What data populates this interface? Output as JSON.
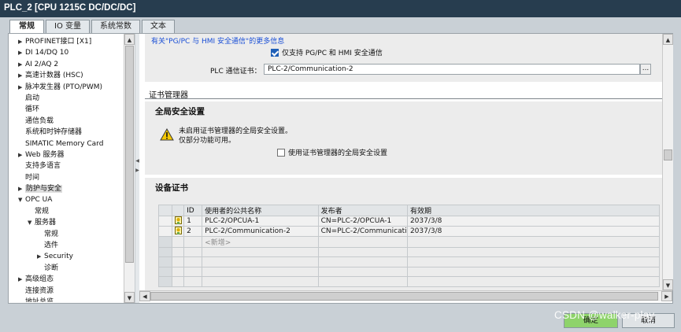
{
  "window": {
    "title": "PLC_2 [CPU 1215C DC/DC/DC]"
  },
  "tabs": [
    {
      "label": "常规",
      "active": true
    },
    {
      "label": "IO 变量",
      "active": false
    },
    {
      "label": "系统常数",
      "active": false
    },
    {
      "label": "文本",
      "active": false
    }
  ],
  "tree": {
    "items": [
      {
        "label": "PROFINET接口 [X1]",
        "arrow": "▶",
        "selected": false
      },
      {
        "label": "DI 14/DQ 10",
        "arrow": "▶",
        "selected": false
      },
      {
        "label": "AI 2/AQ 2",
        "arrow": "▶",
        "selected": false
      },
      {
        "label": "高速计数器 (HSC)",
        "arrow": "▶",
        "selected": false
      },
      {
        "label": "脉冲发生器 (PTO/PWM)",
        "arrow": "▶",
        "selected": false
      },
      {
        "label": "启动",
        "arrow": "",
        "selected": false
      },
      {
        "label": "循环",
        "arrow": "",
        "selected": false
      },
      {
        "label": "通信负载",
        "arrow": "",
        "selected": false
      },
      {
        "label": "系统和时钟存储器",
        "arrow": "",
        "selected": false
      },
      {
        "label": "SIMATIC Memory Card",
        "arrow": "",
        "selected": false
      },
      {
        "label": "Web 服务器",
        "arrow": "▶",
        "selected": false
      },
      {
        "label": "支持多语言",
        "arrow": "",
        "selected": false
      },
      {
        "label": "时间",
        "arrow": "",
        "selected": false
      },
      {
        "label": "防护与安全",
        "arrow": "▶",
        "selected": true
      },
      {
        "label": "OPC UA",
        "arrow": "▼",
        "selected": false
      },
      {
        "label": "常规",
        "arrow": "",
        "selected": false
      },
      {
        "label": "服务器",
        "arrow": "▼",
        "selected": false
      },
      {
        "label": "常规",
        "arrow": "",
        "selected": false
      },
      {
        "label": "选件",
        "arrow": "",
        "selected": false
      },
      {
        "label": "Security",
        "arrow": "▶",
        "selected": false
      },
      {
        "label": "诊断",
        "arrow": "",
        "selected": false
      },
      {
        "label": "高级组态",
        "arrow": "▶",
        "selected": false
      },
      {
        "label": "连接资源",
        "arrow": "",
        "selected": false
      },
      {
        "label": "地址总览",
        "arrow": "",
        "selected": false
      }
    ]
  },
  "comm": {
    "more_info_link": "有关\"PG/PC 与 HMI 安全通信\"的更多信息",
    "only_secure_label": "仅支持 PG/PC 和 HMI 安全通信",
    "only_secure_checked": true,
    "cert_label": "PLC 通信证书：",
    "cert_value": "PLC-2/Communication-2",
    "browse_label": "..."
  },
  "cert_manager": {
    "heading": "证书管理器",
    "global_heading": "全局安全设置",
    "warning_line1": "未启用证书管理器的全局安全设置。",
    "warning_line2": "仅部分功能可用。",
    "use_global_label": "使用证书管理器的全局安全设置",
    "use_global_checked": false
  },
  "device_certs": {
    "heading": "设备证书",
    "columns": [
      "ID",
      "使用者的公共名称",
      "发布者",
      "有效期"
    ],
    "rows": [
      {
        "id": "1",
        "subject": "PLC-2/OPCUA-1",
        "issuer": "CN=PLC-2/OPCUA-1",
        "valid": "2037/3/8"
      },
      {
        "id": "2",
        "subject": "PLC-2/Communication-2",
        "issuer": "CN=PLC-2/Communicati...",
        "valid": "2037/3/8"
      }
    ],
    "new_row_label": "<新增>"
  },
  "footer": {
    "ok_label": "确定",
    "cancel_label": "取消"
  },
  "watermark": "CSDN @walker-play",
  "colors": {
    "titlebar": "#273d4f",
    "ok_button": "#8ed36b",
    "link": "#1a4fd6",
    "checkbox_checked": "#1f5fb7"
  }
}
